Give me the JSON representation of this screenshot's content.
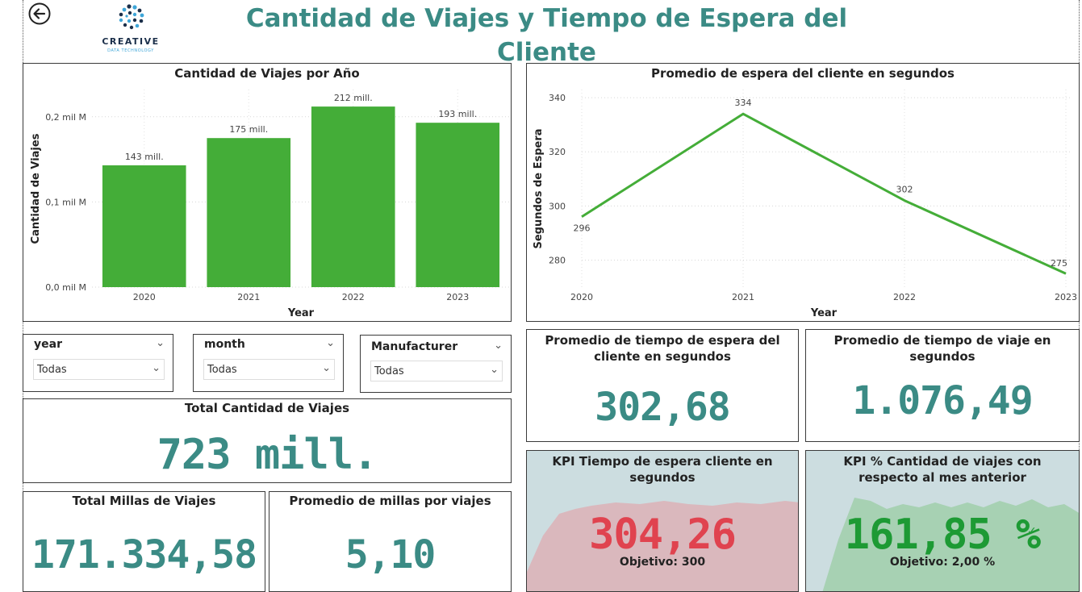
{
  "header": {
    "title": "Cantidad de Viajes y Tiempo de Espera del Cliente",
    "logo_word": "CREATIVE",
    "logo_sub": "DATA TECHNOLOGY"
  },
  "colors": {
    "accent": "#3b8b85",
    "bar": "#44ad38",
    "line": "#44ad38",
    "bad": "#e0434f",
    "good": "#1d9a34"
  },
  "bar_chart": {
    "title": "Cantidad de Viajes por Año",
    "ylabel": "Cantidad de Viajes",
    "xlabel": "Year"
  },
  "line_chart": {
    "title": "Promedio de espera del cliente en segundos",
    "ylabel": "Segundos de Espera",
    "xlabel": "Year"
  },
  "chart_data": [
    {
      "type": "bar",
      "title": "Cantidad de Viajes por Año",
      "xlabel": "Year",
      "ylabel": "Cantidad de Viajes",
      "categories": [
        "2020",
        "2021",
        "2022",
        "2023"
      ],
      "values": [
        143,
        175,
        212,
        193
      ],
      "data_labels": [
        "143 mill.",
        "175 mill.",
        "212 mill.",
        "193 mill."
      ],
      "yticks": [
        0,
        100,
        200
      ],
      "ytick_labels": [
        "0,0 mil M",
        "0,1 mil M",
        "0,2 mil M"
      ],
      "ylim": [
        0,
        232
      ],
      "grid": true
    },
    {
      "type": "line",
      "title": "Promedio de espera del cliente en segundos",
      "xlabel": "Year",
      "ylabel": "Segundos de Espera",
      "categories": [
        "2020",
        "2021",
        "2022",
        "2023"
      ],
      "values": [
        296,
        334,
        302,
        275
      ],
      "yticks": [
        280,
        300,
        320,
        340
      ],
      "ylim": [
        270,
        343
      ],
      "grid": true
    }
  ],
  "slicers": [
    {
      "label": "year",
      "value": "Todas"
    },
    {
      "label": "month",
      "value": "Todas"
    },
    {
      "label": "Manufacturer",
      "value": "Todas"
    }
  ],
  "cards": {
    "total_viajes": {
      "title": "Total Cantidad de Viajes",
      "value": "723 mill."
    },
    "total_millas": {
      "title": "Total Millas de Viajes",
      "value": "171.334,58"
    },
    "prom_millas": {
      "title": "Promedio de millas por viajes",
      "value": "5,10"
    },
    "prom_espera": {
      "title": "Promedio de tiempo de espera del cliente en segundos",
      "value": "302,68"
    },
    "prom_viaje": {
      "title": "Promedio de tiempo de viaje en segundos",
      "value": "1.076,49"
    }
  },
  "kpis": {
    "espera": {
      "title": "KPI Tiempo de espera cliente en segundos",
      "value": "304,26",
      "goal": "Objetivo: 300",
      "status_icon": "!"
    },
    "viajes": {
      "title": "KPI % Cantidad de viajes con respecto al mes anterior",
      "value": "161,85 %",
      "goal": "Objetivo: 2,00 %",
      "status_icon": "✓"
    }
  }
}
